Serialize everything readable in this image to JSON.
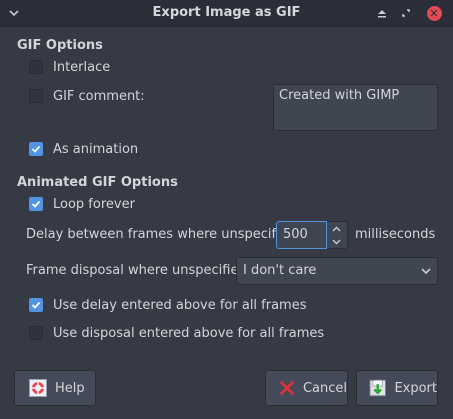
{
  "window": {
    "title": "Export Image as GIF"
  },
  "gif_options": {
    "header": "GIF Options",
    "interlace": {
      "label": "Interlace",
      "checked": false
    },
    "gif_comment": {
      "label": "GIF comment:",
      "checked": false
    },
    "comment_text": "Created with GIMP",
    "as_animation": {
      "label": "As animation",
      "checked": true
    }
  },
  "animated_options": {
    "header": "Animated GIF Options",
    "loop_forever": {
      "label": "Loop forever",
      "checked": true
    },
    "delay_label": "Delay between frames where unspecified:",
    "delay_value": "500",
    "delay_unit": "milliseconds",
    "disposal_label": "Frame disposal where unspecified:",
    "disposal_value": "I don't care",
    "use_delay": {
      "label": "Use delay entered above for all frames",
      "checked": true
    },
    "use_disposal": {
      "label": "Use disposal entered above for all frames",
      "checked": false
    }
  },
  "buttons": {
    "help": "Help",
    "cancel": "Cancel",
    "export": "Export"
  },
  "colors": {
    "accent": "#5294e2",
    "close": "#e04a55",
    "background": "#363a45"
  }
}
